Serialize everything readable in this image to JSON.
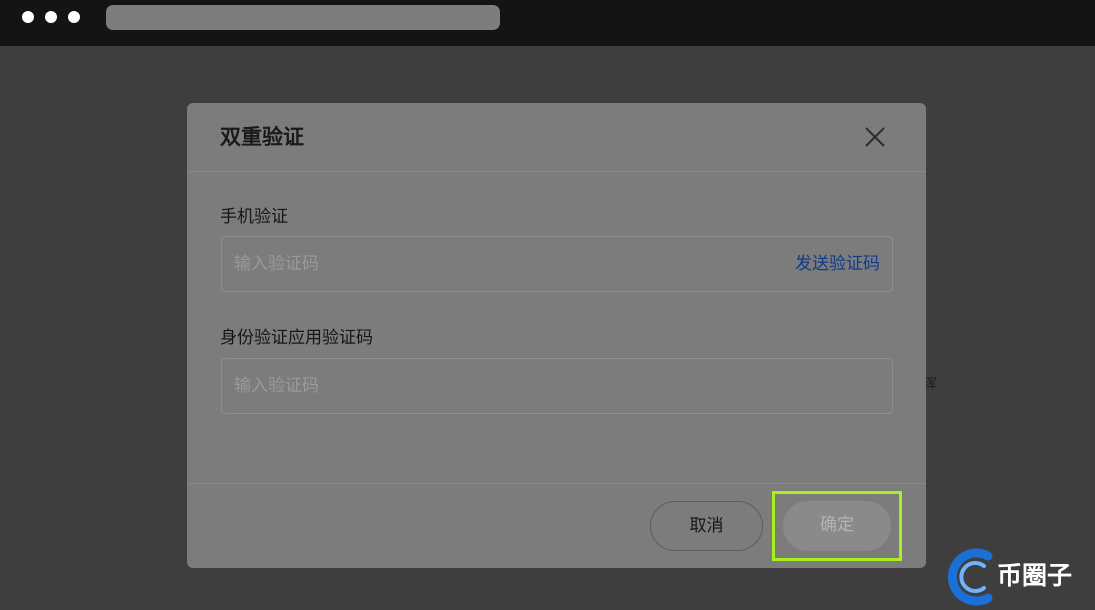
{
  "dialog": {
    "title": "双重验证",
    "phone_label": "手机验证",
    "phone_placeholder": "输入验证码",
    "send_code_label": "发送验证码",
    "auth_label": "身份验证应用验证码",
    "auth_placeholder": "输入验证码",
    "cancel_label": "取消",
    "confirm_label": "确定"
  },
  "side_glyph": "浑",
  "watermark": {
    "text": "币圈子"
  },
  "colors": {
    "link": "#0f3a8a",
    "highlight": "#a8f01e",
    "watermark_blue": "#1b6fd6"
  }
}
